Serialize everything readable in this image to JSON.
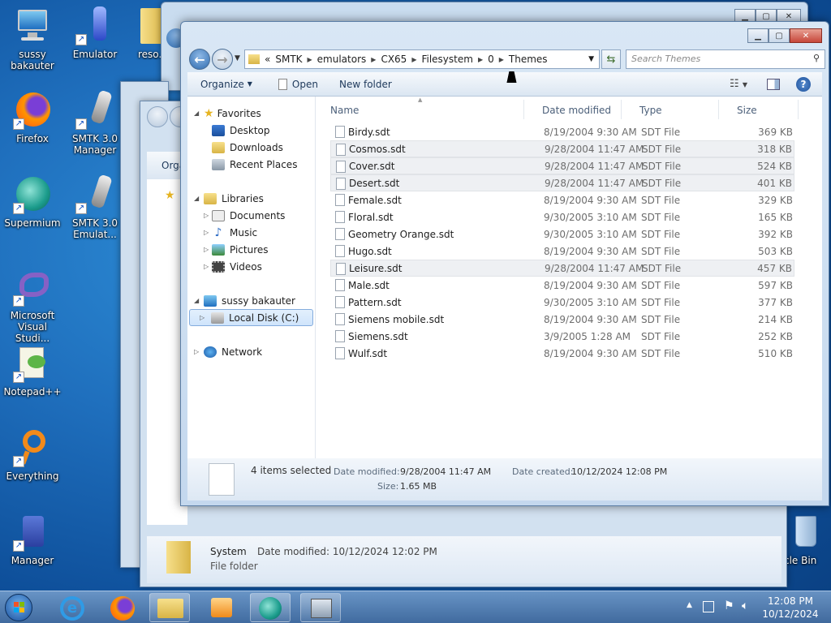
{
  "desktop": {
    "icons": [
      {
        "label": "sussy bakauter"
      },
      {
        "label": "Firefox"
      },
      {
        "label": "Supermium"
      },
      {
        "label": "Microsoft Visual Studi..."
      },
      {
        "label": "Notepad++"
      },
      {
        "label": "Everything"
      },
      {
        "label": "Manager"
      },
      {
        "label": "Emulator"
      },
      {
        "label": "SMTK 3.0 Manager"
      },
      {
        "label": "SMTK 3.0 Emulat..."
      },
      {
        "label": "reso..."
      },
      {
        "label": "cle Bin"
      }
    ]
  },
  "bg_window": {
    "toolbar_label": "Orga",
    "details_name": "System",
    "details_type": "File folder",
    "details_modified": "Date modified: 10/12/2024 12:02 PM"
  },
  "explorer": {
    "address": {
      "prefix": "«",
      "crumbs": [
        "SMTK",
        "emulators",
        "CX65",
        "Filesystem",
        "0",
        "Themes"
      ]
    },
    "search_placeholder": "Search Themes",
    "toolbar": {
      "organize": "Organize",
      "open": "Open",
      "new_folder": "New folder"
    },
    "nav": {
      "favorites": "Favorites",
      "desktop": "Desktop",
      "downloads": "Downloads",
      "recent": "Recent Places",
      "libraries": "Libraries",
      "documents": "Documents",
      "music": "Music",
      "pictures": "Pictures",
      "videos": "Videos",
      "computer": "sussy bakauter",
      "local_disk": "Local Disk (C:)",
      "network": "Network"
    },
    "columns": {
      "name": "Name",
      "date": "Date modified",
      "type": "Type",
      "size": "Size"
    },
    "files": [
      {
        "name": "Birdy.sdt",
        "date": "8/19/2004 9:30 AM",
        "type": "SDT File",
        "size": "369 KB",
        "selected": false
      },
      {
        "name": "Cosmos.sdt",
        "date": "9/28/2004 11:47 AM",
        "type": "SDT File",
        "size": "318 KB",
        "selected": true
      },
      {
        "name": "Cover.sdt",
        "date": "9/28/2004 11:47 AM",
        "type": "SDT File",
        "size": "524 KB",
        "selected": true
      },
      {
        "name": "Desert.sdt",
        "date": "9/28/2004 11:47 AM",
        "type": "SDT File",
        "size": "401 KB",
        "selected": true
      },
      {
        "name": "Female.sdt",
        "date": "8/19/2004 9:30 AM",
        "type": "SDT File",
        "size": "329 KB",
        "selected": false
      },
      {
        "name": "Floral.sdt",
        "date": "9/30/2005 3:10 AM",
        "type": "SDT File",
        "size": "165 KB",
        "selected": false
      },
      {
        "name": "Geometry Orange.sdt",
        "date": "9/30/2005 3:10 AM",
        "type": "SDT File",
        "size": "392 KB",
        "selected": false
      },
      {
        "name": "Hugo.sdt",
        "date": "8/19/2004 9:30 AM",
        "type": "SDT File",
        "size": "503 KB",
        "selected": false
      },
      {
        "name": "Leisure.sdt",
        "date": "9/28/2004 11:47 AM",
        "type": "SDT File",
        "size": "457 KB",
        "selected": true
      },
      {
        "name": "Male.sdt",
        "date": "8/19/2004 9:30 AM",
        "type": "SDT File",
        "size": "597 KB",
        "selected": false
      },
      {
        "name": "Pattern.sdt",
        "date": "9/30/2005 3:10 AM",
        "type": "SDT File",
        "size": "377 KB",
        "selected": false
      },
      {
        "name": "Siemens mobile.sdt",
        "date": "8/19/2004 9:30 AM",
        "type": "SDT File",
        "size": "214 KB",
        "selected": false
      },
      {
        "name": "Siemens.sdt",
        "date": "3/9/2005 1:28 AM",
        "type": "SDT File",
        "size": "252 KB",
        "selected": false
      },
      {
        "name": "Wulf.sdt",
        "date": "8/19/2004 9:30 AM",
        "type": "SDT File",
        "size": "510 KB",
        "selected": false
      }
    ],
    "details": {
      "count": "4 items selected",
      "modified_label": "Date modified:",
      "modified_value": "9/28/2004 11:47 AM",
      "created_label": "Date created:",
      "created_value": "10/12/2024 12:08 PM",
      "size_label": "Size:",
      "size_value": "1.65 MB"
    }
  },
  "taskbar": {
    "time": "12:08 PM",
    "date": "10/12/2024"
  }
}
